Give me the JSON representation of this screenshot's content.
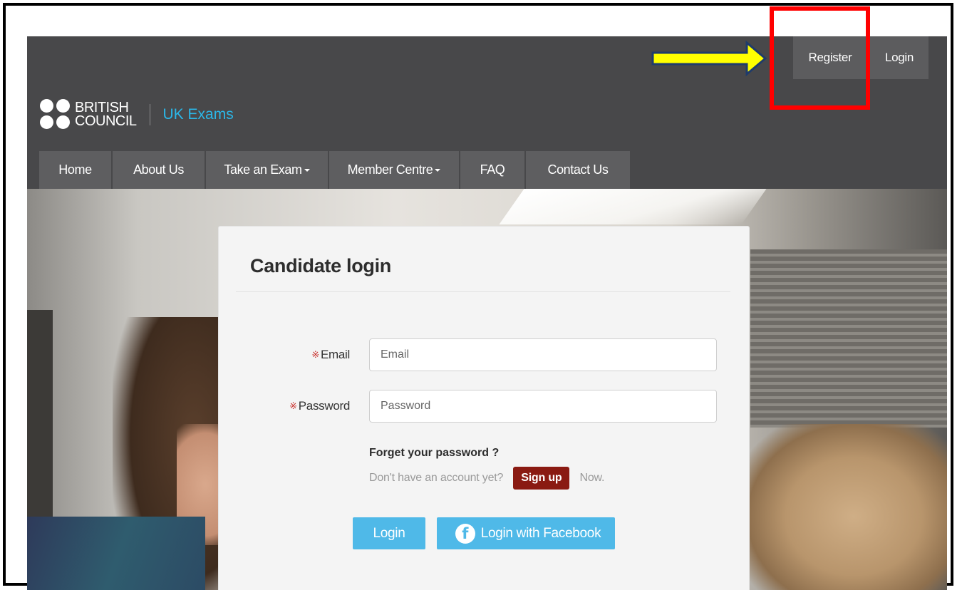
{
  "header": {
    "auth": {
      "register_label": "Register",
      "login_label": "Login"
    },
    "logo": {
      "line1": "BRITISH",
      "line2": "COUNCIL",
      "sub": "UK Exams"
    },
    "nav": [
      {
        "label": "Home",
        "dropdown": false
      },
      {
        "label": "About Us",
        "dropdown": false
      },
      {
        "label": "Take an Exam",
        "dropdown": true
      },
      {
        "label": "Member Centre",
        "dropdown": true
      },
      {
        "label": "FAQ",
        "dropdown": false
      },
      {
        "label": "Contact Us",
        "dropdown": false
      }
    ]
  },
  "login_card": {
    "title": "Candidate login",
    "required_mark": "※",
    "email": {
      "label": "Email",
      "placeholder": "Email",
      "value": ""
    },
    "password": {
      "label": "Password",
      "placeholder": "Password",
      "value": ""
    },
    "forgot_text": "Forget your password ?",
    "signup_prefix": "Don't have an account yet?",
    "signup_button": "Sign up",
    "signup_suffix": "Now.",
    "login_button": "Login",
    "facebook_button": "Login with Facebook",
    "facebook_icon_glyph": "f"
  },
  "annotation": {
    "box_color": "#ff0000",
    "arrow_color": "#ffff00",
    "arrow_outline": "#1f3b6b"
  },
  "colors": {
    "header_bg": "#48484a",
    "nav_item_bg": "#5e5e60",
    "accent_blue": "#4fb9e8",
    "logo_sub_blue": "#2bb7e8",
    "signup_red": "#8a1a12"
  },
  "icons": {
    "facebook": "facebook-icon",
    "dropdown": "chevron-down-icon",
    "logo": "british-council-logo-icon",
    "required": "required-asterisk-icon"
  }
}
